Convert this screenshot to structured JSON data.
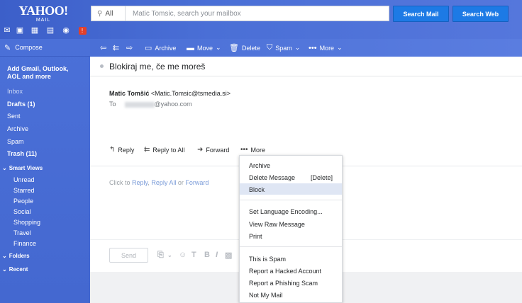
{
  "logo": {
    "brand": "YAHOO!",
    "product": "MAIL"
  },
  "search": {
    "scope": "All",
    "placeholder": "Matic Tomsic, search your mailbox",
    "mail_button": "Search Mail",
    "web_button": "Search Web"
  },
  "sidebar": {
    "compose": "Compose",
    "add_accounts": [
      "Add Gmail, Outlook,",
      "AOL and more"
    ],
    "folders": [
      {
        "label": "Inbox"
      },
      {
        "label": "Drafts (1)"
      },
      {
        "label": "Sent"
      },
      {
        "label": "Archive"
      },
      {
        "label": "Spam"
      },
      {
        "label": "Trash (11)"
      }
    ],
    "smart_views": {
      "label": "Smart Views",
      "items": [
        "Unread",
        "Starred",
        "People",
        "Social",
        "Shopping",
        "Travel",
        "Finance"
      ]
    },
    "folders_section": "Folders",
    "recent_section": "Recent"
  },
  "toolbar": {
    "archive": "Archive",
    "move": "Move",
    "delete": "Delete",
    "spam": "Spam",
    "more": "More"
  },
  "message": {
    "subject": "Blokiraj me, če me moreš",
    "from_name": "Matic Tomšić",
    "from_email": "<Matic.Tomsic@tsmedia.si>",
    "to_label": "To",
    "to_domain": "@yahoo.com"
  },
  "actions": {
    "reply": "Reply",
    "reply_all": "Reply to All",
    "forward": "Forward",
    "more": "More"
  },
  "reply_hint": {
    "prefix": "Click to ",
    "reply": "Reply",
    "sep1": ", ",
    "reply_all": "Reply All",
    "sep2": " or ",
    "forward": "Forward"
  },
  "compose": {
    "send": "Send"
  },
  "dropdown": {
    "archive": "Archive",
    "delete": "Delete Message",
    "delete_shortcut": "[Delete]",
    "block": "Block",
    "encoding": "Set Language Encoding...",
    "raw": "View Raw Message",
    "print": "Print",
    "spam": "This is Spam",
    "hacked": "Report a Hacked Account",
    "phishing": "Report a Phishing Scam",
    "not_mine": "Not My Mail"
  },
  "colors": {
    "brand_blue": "#4a6fd6",
    "search_button": "#1d7ae5",
    "highlight": "#dfe6f4"
  }
}
